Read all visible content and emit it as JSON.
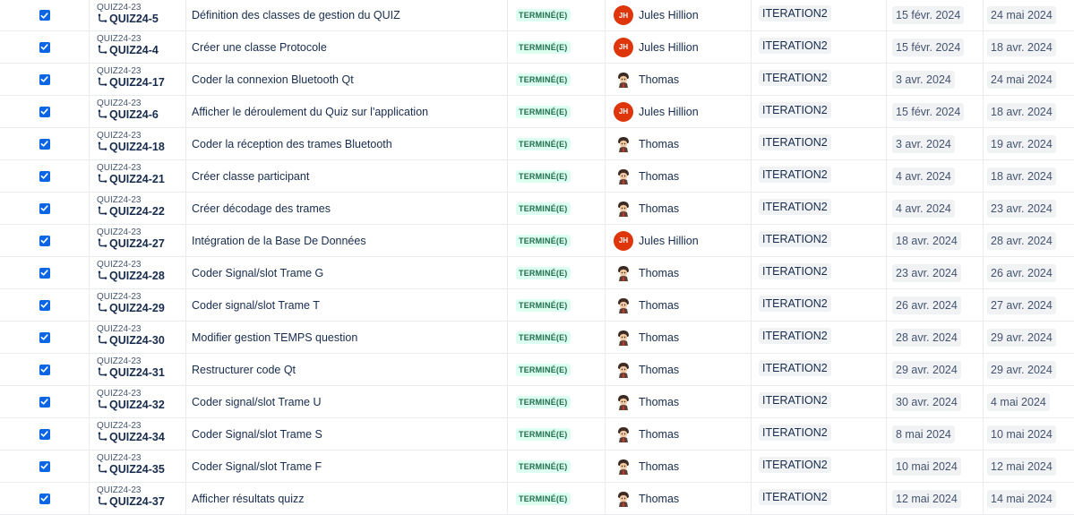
{
  "parent_key": "QUIZ24-23",
  "status_label": "TERMINÉ(E)",
  "colors": {
    "checkbox": "#0c66e4",
    "done_text": "#216e4e",
    "done_bg": "#dcfff1",
    "avatar_jh": "#de350b"
  },
  "rows": [
    {
      "key": "QUIZ24-5",
      "summary": "Définition des classes de gestion du QUIZ",
      "assignee": "Jules Hillion",
      "initials": "JH",
      "sprint": "ITERATION2",
      "start": "15 févr. 2024",
      "due": "24 mai 2024"
    },
    {
      "key": "QUIZ24-4",
      "summary": "Créer une classe Protocole",
      "assignee": "Jules Hillion",
      "initials": "JH",
      "sprint": "ITERATION2",
      "start": "15 févr. 2024",
      "due": "18 avr. 2024"
    },
    {
      "key": "QUIZ24-17",
      "summary": "Coder la connexion Bluetooth Qt",
      "assignee": "Thomas",
      "initials": "",
      "sprint": "ITERATION2",
      "start": "3 avr. 2024",
      "due": "24 mai 2024"
    },
    {
      "key": "QUIZ24-6",
      "summary": "Afficher le déroulement du Quiz sur l'application",
      "assignee": "Jules Hillion",
      "initials": "JH",
      "sprint": "ITERATION2",
      "start": "15 févr. 2024",
      "due": "18 avr. 2024"
    },
    {
      "key": "QUIZ24-18",
      "summary": "Coder la réception des trames Bluetooth",
      "assignee": "Thomas",
      "initials": "",
      "sprint": "ITERATION2",
      "start": "3 avr. 2024",
      "due": "19 avr. 2024"
    },
    {
      "key": "QUIZ24-21",
      "summary": "Créer classe participant",
      "assignee": "Thomas",
      "initials": "",
      "sprint": "ITERATION2",
      "start": "4 avr. 2024",
      "due": "18 avr. 2024"
    },
    {
      "key": "QUIZ24-22",
      "summary": "Créer décodage des trames",
      "assignee": "Thomas",
      "initials": "",
      "sprint": "ITERATION2",
      "start": "4 avr. 2024",
      "due": "23 avr. 2024"
    },
    {
      "key": "QUIZ24-27",
      "summary": "Intégration de la Base De Données",
      "assignee": "Jules Hillion",
      "initials": "JH",
      "sprint": "ITERATION2",
      "start": "18 avr. 2024",
      "due": "28 avr. 2024"
    },
    {
      "key": "QUIZ24-28",
      "summary": "Coder Signal/slot Trame G",
      "assignee": "Thomas",
      "initials": "",
      "sprint": "ITERATION2",
      "start": "23 avr. 2024",
      "due": "26 avr. 2024"
    },
    {
      "key": "QUIZ24-29",
      "summary": "Coder signal/slot Trame T",
      "assignee": "Thomas",
      "initials": "",
      "sprint": "ITERATION2",
      "start": "26 avr. 2024",
      "due": "27 avr. 2024"
    },
    {
      "key": "QUIZ24-30",
      "summary": "Modifier gestion TEMPS question",
      "assignee": "Thomas",
      "initials": "",
      "sprint": "ITERATION2",
      "start": "28 avr. 2024",
      "due": "29 avr. 2024"
    },
    {
      "key": "QUIZ24-31",
      "summary": "Restructurer code Qt",
      "assignee": "Thomas",
      "initials": "",
      "sprint": "ITERATION2",
      "start": "29 avr. 2024",
      "due": "29 avr. 2024"
    },
    {
      "key": "QUIZ24-32",
      "summary": "Coder signal/slot Trame U",
      "assignee": "Thomas",
      "initials": "",
      "sprint": "ITERATION2",
      "start": "30 avr. 2024",
      "due": "4 mai 2024"
    },
    {
      "key": "QUIZ24-34",
      "summary": "Coder Signal/slot Trame S",
      "assignee": "Thomas",
      "initials": "",
      "sprint": "ITERATION2",
      "start": "8 mai 2024",
      "due": "10 mai 2024"
    },
    {
      "key": "QUIZ24-35",
      "summary": "Coder Signal/slot Trame F",
      "assignee": "Thomas",
      "initials": "",
      "sprint": "ITERATION2",
      "start": "10 mai 2024",
      "due": "12 mai 2024"
    },
    {
      "key": "QUIZ24-37",
      "summary": "Afficher résultats quizz",
      "assignee": "Thomas",
      "initials": "",
      "sprint": "ITERATION2",
      "start": "12 mai 2024",
      "due": "14 mai 2024"
    }
  ]
}
